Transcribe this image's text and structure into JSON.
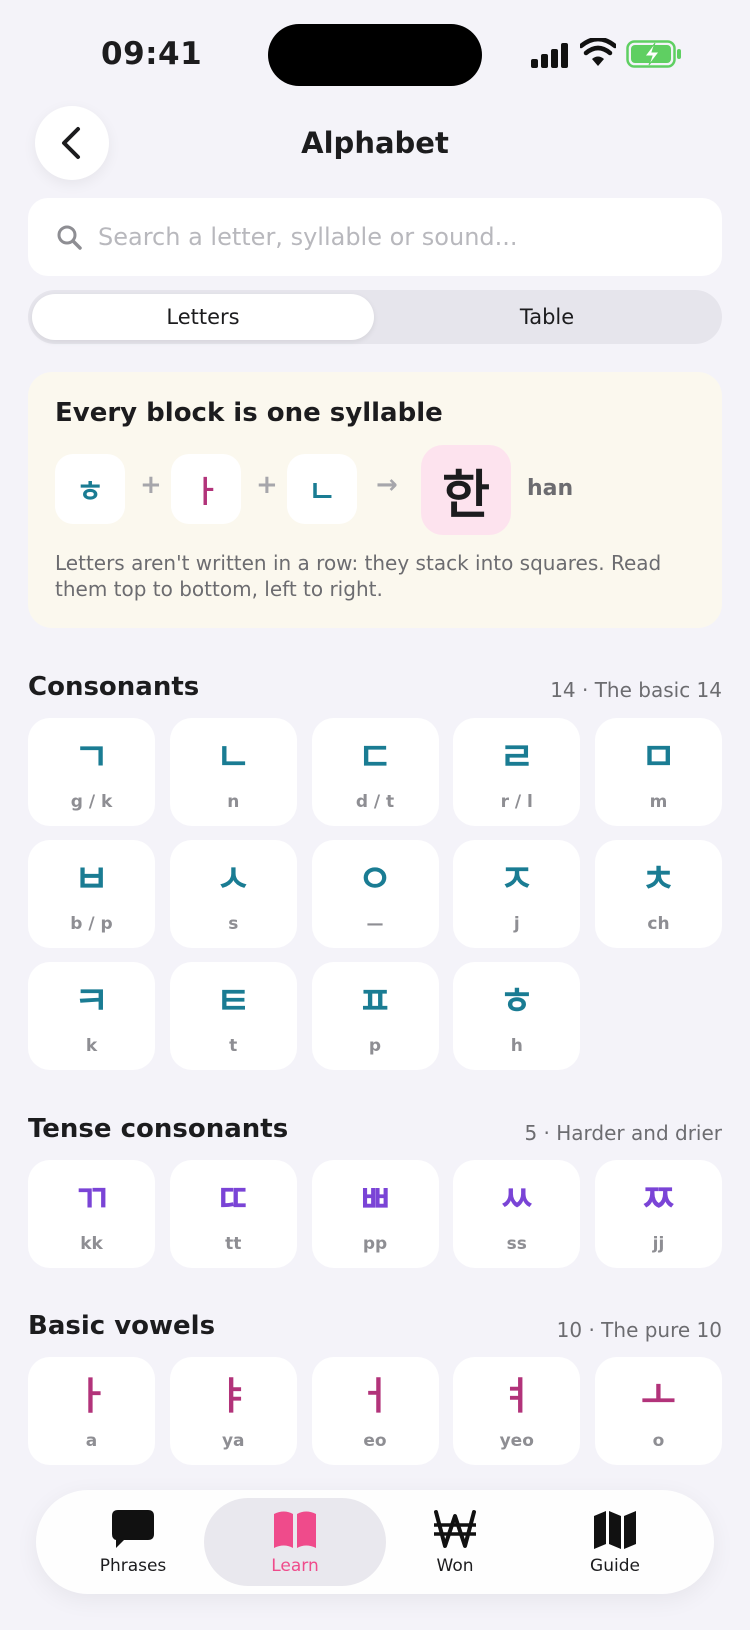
{
  "status_bar": {
    "time": "09:41"
  },
  "header": {
    "title": "Alphabet"
  },
  "search": {
    "placeholder": "Search a letter, syllable or sound..."
  },
  "segments": {
    "letters": "Letters",
    "table": "Table"
  },
  "intro": {
    "title": "Every block is one syllable",
    "parts": [
      "ㅎ",
      "ㅏ",
      "ㄴ"
    ],
    "plus": "+",
    "arrow": "→",
    "result": "한",
    "result_roman": "han",
    "description": "Letters aren't written in a row: they stack into squares. Read them top to bottom, left to right."
  },
  "sections": {
    "consonants": {
      "title": "Consonants",
      "meta": "14 · The basic 14",
      "items": [
        {
          "glyph": "ㄱ",
          "roman": "g / k"
        },
        {
          "glyph": "ㄴ",
          "roman": "n"
        },
        {
          "glyph": "ㄷ",
          "roman": "d / t"
        },
        {
          "glyph": "ㄹ",
          "roman": "r / l"
        },
        {
          "glyph": "ㅁ",
          "roman": "m"
        },
        {
          "glyph": "ㅂ",
          "roman": "b / p"
        },
        {
          "glyph": "ㅅ",
          "roman": "s"
        },
        {
          "glyph": "ㅇ",
          "roman": "—"
        },
        {
          "glyph": "ㅈ",
          "roman": "j"
        },
        {
          "glyph": "ㅊ",
          "roman": "ch"
        },
        {
          "glyph": "ㅋ",
          "roman": "k"
        },
        {
          "glyph": "ㅌ",
          "roman": "t"
        },
        {
          "glyph": "ㅍ",
          "roman": "p"
        },
        {
          "glyph": "ㅎ",
          "roman": "h"
        }
      ]
    },
    "tense": {
      "title": "Tense consonants",
      "meta": "5 · Harder and drier",
      "items": [
        {
          "glyph": "ㄲ",
          "roman": "kk"
        },
        {
          "glyph": "ㄸ",
          "roman": "tt"
        },
        {
          "glyph": "ㅃ",
          "roman": "pp"
        },
        {
          "glyph": "ㅆ",
          "roman": "ss"
        },
        {
          "glyph": "ㅉ",
          "roman": "jj"
        }
      ]
    },
    "vowels": {
      "title": "Basic vowels",
      "meta": "10 · The pure 10",
      "items": [
        {
          "glyph": "ㅏ",
          "roman": "a"
        },
        {
          "glyph": "ㅑ",
          "roman": "ya"
        },
        {
          "glyph": "ㅓ",
          "roman": "eo"
        },
        {
          "glyph": "ㅕ",
          "roman": "yeo"
        },
        {
          "glyph": "ㅗ",
          "roman": "o"
        }
      ]
    }
  },
  "tabbar": {
    "tabs": [
      {
        "label": "Phrases",
        "icon": "chat-bubble-icon"
      },
      {
        "label": "Learn",
        "icon": "book-icon"
      },
      {
        "label": "Won",
        "icon": "won-icon"
      },
      {
        "label": "Guide",
        "icon": "map-icon"
      }
    ],
    "active": "Learn",
    "accent": "#ef4b8b"
  },
  "colors": {
    "consonant": "#1a7c93",
    "tense": "#7a44d6",
    "vowel": "#b2337a",
    "background": "#f4f3f9"
  }
}
